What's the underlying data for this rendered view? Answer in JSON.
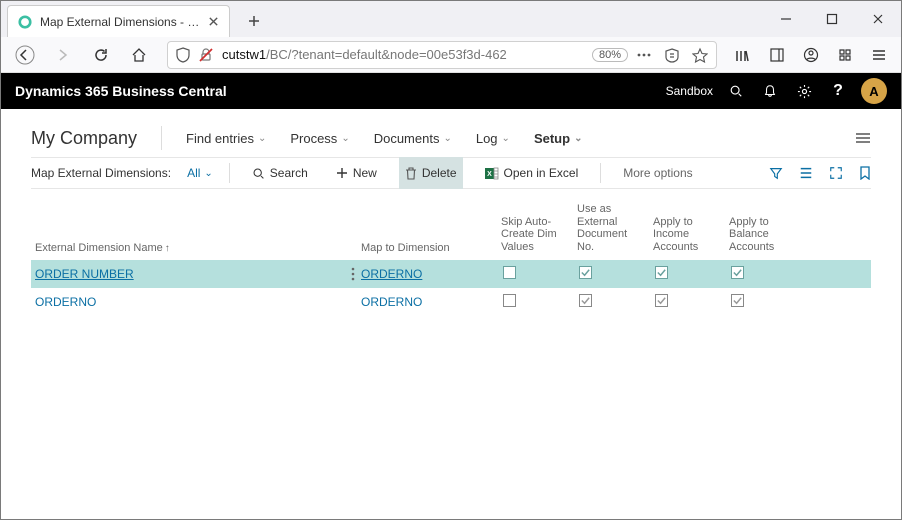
{
  "browser": {
    "tab_title": "Map External Dimensions - Dyn",
    "url_host": "cutstw1",
    "url_path": "/BC/?tenant=default&node=00e53f3d-462",
    "zoom": "80%"
  },
  "app": {
    "title": "Dynamics 365 Business Central",
    "environment": "Sandbox",
    "avatar": "A"
  },
  "page": {
    "company": "My Company",
    "menu": {
      "find": "Find entries",
      "process": "Process",
      "documents": "Documents",
      "log": "Log",
      "setup": "Setup"
    }
  },
  "toolbar": {
    "label": "Map External Dimensions:",
    "filter": "All",
    "search": "Search",
    "new": "New",
    "delete": "Delete",
    "excel": "Open in Excel",
    "more": "More options"
  },
  "grid": {
    "headers": {
      "name": "External Dimension Name",
      "map": "Map to Dimension",
      "skip": "Skip Auto-Create Dim Values",
      "extdoc": "Use as External Document No.",
      "income": "Apply to Income Accounts",
      "balance": "Apply to Balance Accounts"
    },
    "rows": [
      {
        "name": "ORDER NUMBER",
        "map": "ORDERNO",
        "skip": false,
        "extdoc": true,
        "income": true,
        "balance": true,
        "selected": true
      },
      {
        "name": "ORDERNO",
        "map": "ORDERNO",
        "skip": false,
        "extdoc": true,
        "income": true,
        "balance": true,
        "selected": false
      }
    ]
  }
}
